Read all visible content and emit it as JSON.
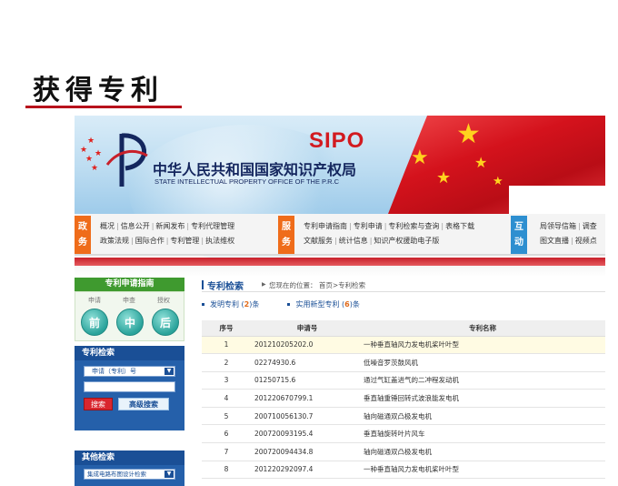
{
  "slide": {
    "title": "获得专利"
  },
  "banner": {
    "sipo": "SIPO",
    "cn_name": "中华人民共和国国家知识产权局",
    "en_name": "STATE INTELLECTUAL PROPERTY OFFICE OF THE P.R.C"
  },
  "nav": {
    "group1": {
      "tag": "政务",
      "line1": [
        "概况",
        "信息公开",
        "新闻发布",
        "专利代理管理"
      ],
      "line2": [
        "政策法规",
        "国际合作",
        "专利管理",
        "执法维权"
      ]
    },
    "group2": {
      "tag": "服务",
      "line1": [
        "专利申请指南",
        "专利申请",
        "专利检索与查询",
        "表格下载"
      ],
      "line2": [
        "文献服务",
        "统计信息",
        "知识产权援助电子版"
      ]
    },
    "group3": {
      "tag": "互动",
      "line1": [
        "局领导信箱",
        "调查"
      ],
      "line2": [
        "图文直播",
        "视频点"
      ]
    }
  },
  "sidebar": {
    "guide_title": "专利申请指南",
    "steps": [
      {
        "label": "申请",
        "char": "前"
      },
      {
        "label": "申查",
        "char": "中"
      },
      {
        "label": "授权",
        "char": "后"
      }
    ],
    "search_title": "专利检索",
    "search_select": "申请（专利）号",
    "search_button": "搜索",
    "advanced_button": "高级搜索",
    "other_title": "其他检索",
    "other_select": "集成电路布图设计检索"
  },
  "main": {
    "section_title": "专利检索",
    "location": "您现在的位置：  首页>专利检索",
    "invention_label": "发明专利",
    "invention_count": "2",
    "utility_label": "实用新型专利",
    "utility_count": "6",
    "count_unit": "条",
    "columns": [
      "序号",
      "申请号",
      "专利名称"
    ],
    "rows": [
      {
        "no": "1",
        "app": "201210205202.0",
        "name": "一种垂直轴风力发电机桨叶叶型"
      },
      {
        "no": "2",
        "app": "02274930.6",
        "name": "低噪音罗茨鼓风机"
      },
      {
        "no": "3",
        "app": "01250715.6",
        "name": "通过气缸盖进气的二冲程发动机"
      },
      {
        "no": "4",
        "app": "201220670799.1",
        "name": "垂直轴重锤回转式波浪能发电机"
      },
      {
        "no": "5",
        "app": "200710056130.7",
        "name": "轴向磁通双凸极发电机"
      },
      {
        "no": "6",
        "app": "200720093195.4",
        "name": "垂直轴旋转叶片风车"
      },
      {
        "no": "7",
        "app": "200720094434.8",
        "name": "轴向磁通双凸极发电机"
      },
      {
        "no": "8",
        "app": "201220292097.4",
        "name": "一种垂直轴风力发电机桨叶叶型"
      }
    ]
  },
  "colors": {
    "accent_red": "#d21a20",
    "navy": "#1a4f96",
    "green": "#3f9a2f",
    "orange": "#ef6c1a"
  }
}
